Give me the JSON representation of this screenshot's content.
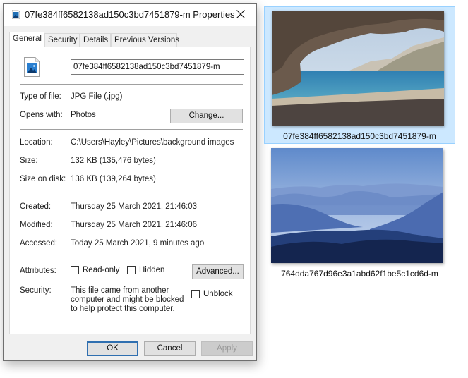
{
  "window": {
    "title": "07fe384ff6582138ad150c3bd7451879-m Properties",
    "title_icon": "image-file-icon",
    "close_icon": "close-icon"
  },
  "tabs": [
    {
      "label": "General",
      "active": true
    },
    {
      "label": "Security",
      "active": false
    },
    {
      "label": "Details",
      "active": false
    },
    {
      "label": "Previous Versions",
      "active": false
    }
  ],
  "general": {
    "file_icon": "image-file-icon",
    "file_name": "07fe384ff6582138ad150c3bd7451879-m",
    "type_label": "Type of file:",
    "type_value": "JPG File (.jpg)",
    "opens_label": "Opens with:",
    "opens_value": "Photos",
    "change_button": "Change...",
    "location_label": "Location:",
    "location_value": "C:\\Users\\Hayley\\Pictures\\background images",
    "size_label": "Size:",
    "size_value": "132 KB (135,476 bytes)",
    "size_disk_label": "Size on disk:",
    "size_disk_value": "136 KB (139,264 bytes)",
    "created_label": "Created:",
    "created_value": "Thursday 25 March 2021, 21:46:03",
    "modified_label": "Modified:",
    "modified_value": "Thursday 25 March 2021, 21:46:06",
    "accessed_label": "Accessed:",
    "accessed_value": "Today 25 March 2021, 9 minutes ago",
    "attributes_label": "Attributes:",
    "readonly_label": "Read-only",
    "readonly_checked": false,
    "hidden_label": "Hidden",
    "hidden_checked": false,
    "advanced_button": "Advanced...",
    "security_label": "Security:",
    "security_text": "This file came from another computer and might be blocked to help protect this computer.",
    "unblock_label": "Unblock",
    "unblock_checked": false
  },
  "footer": {
    "ok": "OK",
    "cancel": "Cancel",
    "apply": "Apply"
  },
  "explorer": {
    "items": [
      {
        "name": "07fe384ff6582138ad150c3bd7451879-m",
        "selected": true,
        "thumbnail": "beach-cave-photo"
      },
      {
        "name": "764dda767d96e3a1abd62f1be5c1cd6d-m",
        "selected": false,
        "thumbnail": "misty-mountains-photo"
      }
    ],
    "selection_color": "#cce8ff"
  }
}
